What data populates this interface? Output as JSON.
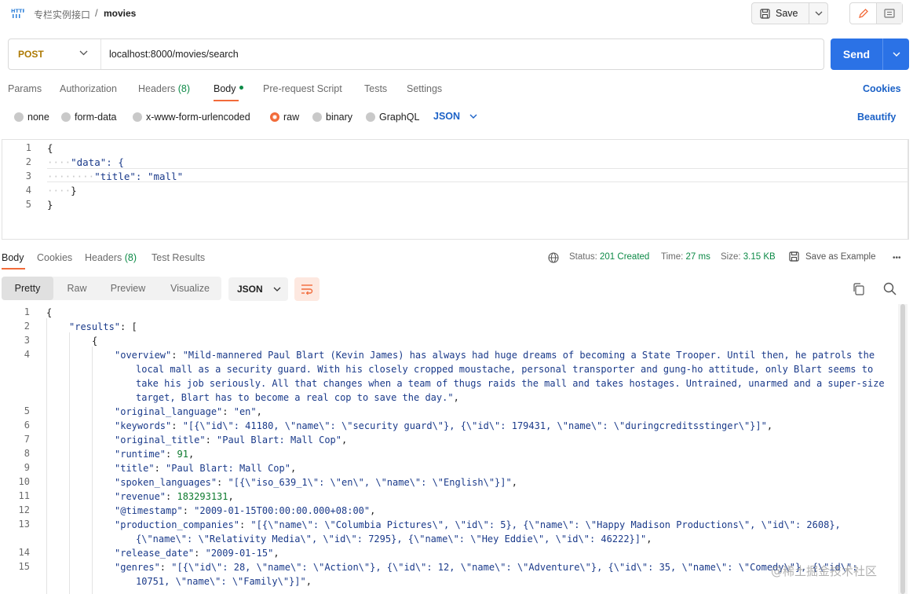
{
  "breadcrumb": {
    "parent": "专栏实例接口",
    "separator": "/",
    "current": "movies"
  },
  "toolbar": {
    "save_label": "Save"
  },
  "request": {
    "method": "POST",
    "url": "localhost:8000/movies/search",
    "send_label": "Send"
  },
  "request_tabs": [
    {
      "label": "Params"
    },
    {
      "label": "Authorization"
    },
    {
      "label": "Headers",
      "count": "(8)"
    },
    {
      "label": "Body"
    },
    {
      "label": "Pre-request Script"
    },
    {
      "label": "Tests"
    },
    {
      "label": "Settings"
    }
  ],
  "cookies_label": "Cookies",
  "body_types": [
    "none",
    "form-data",
    "x-www-form-urlencoded",
    "raw",
    "binary",
    "GraphQL"
  ],
  "body_type_selected": "raw",
  "body_format": "JSON",
  "beautify_label": "Beautify",
  "request_body_lines": [
    {
      "n": "1",
      "text": "{"
    },
    {
      "n": "2",
      "text": "\"data\": {"
    },
    {
      "n": "3",
      "text": "\"title\": \"mall\""
    },
    {
      "n": "4",
      "text": "}"
    },
    {
      "n": "5",
      "text": "}"
    }
  ],
  "response_tabs": [
    {
      "label": "Body"
    },
    {
      "label": "Cookies"
    },
    {
      "label": "Headers",
      "count": "(8)"
    },
    {
      "label": "Test Results"
    }
  ],
  "response_status": {
    "status_label": "Status:",
    "status_value": "201 Created",
    "time_label": "Time:",
    "time_value": "27 ms",
    "size_label": "Size:",
    "size_value": "3.15 KB",
    "save_example": "Save as Example",
    "more": "•••"
  },
  "view_modes": [
    "Pretty",
    "Raw",
    "Preview",
    "Visualize"
  ],
  "view_mode_selected": "Pretty",
  "response_format": "JSON",
  "response_lines": [
    {
      "n": "1",
      "indent": 0,
      "parts": [
        [
          "p",
          "{"
        ]
      ]
    },
    {
      "n": "2",
      "indent": 1,
      "parts": [
        [
          "k",
          "\"results\""
        ],
        [
          "p",
          ": ["
        ]
      ]
    },
    {
      "n": "3",
      "indent": 2,
      "parts": [
        [
          "p",
          "{"
        ]
      ]
    },
    {
      "n": "4",
      "indent": 3,
      "parts": [
        [
          "k",
          "\"overview\""
        ],
        [
          "p",
          ": "
        ],
        [
          "s",
          "\"Mild-mannered Paul Blart (Kevin James) has always had huge dreams of becoming a State Trooper. Until then, he patrols the"
        ]
      ]
    },
    {
      "n": "",
      "indent": 4,
      "parts": [
        [
          "s",
          "local mall as a security guard. With his closely cropped moustache, personal transporter and gung-ho attitude, only Blart seems to"
        ]
      ]
    },
    {
      "n": "",
      "indent": 4,
      "parts": [
        [
          "s",
          "take his job seriously. All that changes when a team of thugs raids the mall and takes hostages. Untrained, unarmed and a super-size"
        ]
      ]
    },
    {
      "n": "",
      "indent": 4,
      "parts": [
        [
          "s",
          "target, Blart has to become a real cop to save the day.\""
        ],
        [
          "p",
          ","
        ]
      ]
    },
    {
      "n": "5",
      "indent": 3,
      "parts": [
        [
          "k",
          "\"original_language\""
        ],
        [
          "p",
          ": "
        ],
        [
          "s",
          "\"en\""
        ],
        [
          "p",
          ","
        ]
      ]
    },
    {
      "n": "6",
      "indent": 3,
      "parts": [
        [
          "k",
          "\"keywords\""
        ],
        [
          "p",
          ": "
        ],
        [
          "s",
          "\"[{\\\"id\\\": 41180, \\\"name\\\": \\\"security guard\\\"}, {\\\"id\\\": 179431, \\\"name\\\": \\\"duringcreditsstinger\\\"}]\""
        ],
        [
          "p",
          ","
        ]
      ]
    },
    {
      "n": "7",
      "indent": 3,
      "parts": [
        [
          "k",
          "\"original_title\""
        ],
        [
          "p",
          ": "
        ],
        [
          "s",
          "\"Paul Blart: Mall Cop\""
        ],
        [
          "p",
          ","
        ]
      ]
    },
    {
      "n": "8",
      "indent": 3,
      "parts": [
        [
          "k",
          "\"runtime\""
        ],
        [
          "p",
          ": "
        ],
        [
          "n",
          "91"
        ],
        [
          "p",
          ","
        ]
      ]
    },
    {
      "n": "9",
      "indent": 3,
      "parts": [
        [
          "k",
          "\"title\""
        ],
        [
          "p",
          ": "
        ],
        [
          "s",
          "\"Paul Blart: Mall Cop\""
        ],
        [
          "p",
          ","
        ]
      ]
    },
    {
      "n": "10",
      "indent": 3,
      "parts": [
        [
          "k",
          "\"spoken_languages\""
        ],
        [
          "p",
          ": "
        ],
        [
          "s",
          "\"[{\\\"iso_639_1\\\": \\\"en\\\", \\\"name\\\": \\\"English\\\"}]\""
        ],
        [
          "p",
          ","
        ]
      ]
    },
    {
      "n": "11",
      "indent": 3,
      "parts": [
        [
          "k",
          "\"revenue\""
        ],
        [
          "p",
          ": "
        ],
        [
          "n",
          "183293131"
        ],
        [
          "p",
          ","
        ]
      ]
    },
    {
      "n": "12",
      "indent": 3,
      "parts": [
        [
          "k",
          "\"@timestamp\""
        ],
        [
          "p",
          ": "
        ],
        [
          "s",
          "\"2009-01-15T00:00:00.000+08:00\""
        ],
        [
          "p",
          ","
        ]
      ]
    },
    {
      "n": "13",
      "indent": 3,
      "parts": [
        [
          "k",
          "\"production_companies\""
        ],
        [
          "p",
          ": "
        ],
        [
          "s",
          "\"[{\\\"name\\\": \\\"Columbia Pictures\\\", \\\"id\\\": 5}, {\\\"name\\\": \\\"Happy Madison Productions\\\", \\\"id\\\": 2608},"
        ]
      ]
    },
    {
      "n": "",
      "indent": 4,
      "parts": [
        [
          "s",
          "{\\\"name\\\": \\\"Relativity Media\\\", \\\"id\\\": 7295}, {\\\"name\\\": \\\"Hey Eddie\\\", \\\"id\\\": 46222}]\""
        ],
        [
          "p",
          ","
        ]
      ]
    },
    {
      "n": "14",
      "indent": 3,
      "parts": [
        [
          "k",
          "\"release_date\""
        ],
        [
          "p",
          ": "
        ],
        [
          "s",
          "\"2009-01-15\""
        ],
        [
          "p",
          ","
        ]
      ]
    },
    {
      "n": "15",
      "indent": 3,
      "parts": [
        [
          "k",
          "\"genres\""
        ],
        [
          "p",
          ": "
        ],
        [
          "s",
          "\"[{\\\"id\\\": 28, \\\"name\\\": \\\"Action\\\"}, {\\\"id\\\": 12, \\\"name\\\": \\\"Adventure\\\"}, {\\\"id\\\": 35, \\\"name\\\": \\\"Comedy\\\"}, {\\\"id\\\":"
        ]
      ]
    },
    {
      "n": "",
      "indent": 4,
      "parts": [
        [
          "s",
          "10751, \\\"name\\\": \\\"Family\\\"}]\""
        ],
        [
          "p",
          ","
        ]
      ]
    }
  ],
  "watermark": "@稀土掘金技术社区",
  "colors": {
    "accent": "#f26b3a",
    "primary": "#2b72e6",
    "link": "#1c62c7",
    "success": "#0d8a47",
    "method_post": "#ad7a03"
  }
}
